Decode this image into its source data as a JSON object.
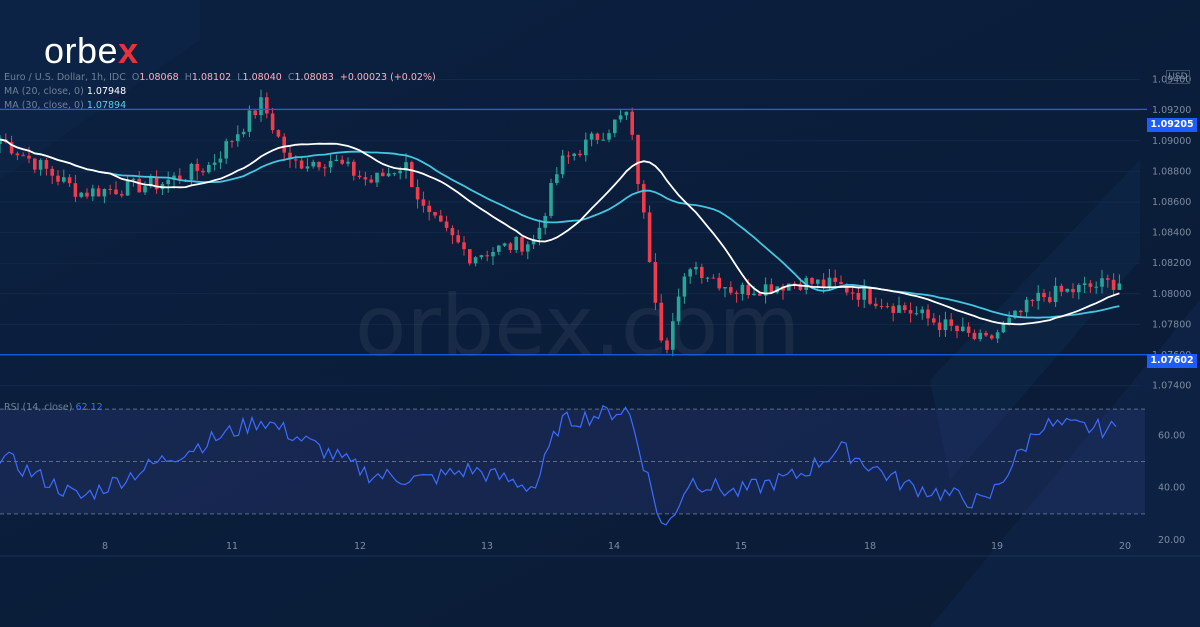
{
  "brand": {
    "logo_main": "orbe",
    "logo_accent": "x",
    "watermark": "orbex.com"
  },
  "legend": {
    "symbol": "Euro / U.S. Dollar, 1h, IDC",
    "o_label": "O",
    "o_value": "1.08068",
    "h_label": "H",
    "h_value": "1.08102",
    "l_label": "L",
    "l_value": "1.08040",
    "c_label": "C",
    "c_value": "1.08083",
    "change": "+0.00023 (+0.02%)",
    "ma20_label": "MA (20, close, 0)",
    "ma20_value": "1.07948",
    "ma30_label": "MA (30, close, 0)",
    "ma30_value": "1.07894",
    "rsi_label": "RSI (14, close)",
    "rsi_value": "62.12"
  },
  "colors": {
    "background": "#0b1f3b",
    "up": "#26a69a",
    "down": "#ef3b4b",
    "ma20": "#ffffff",
    "ma30": "#45c6e0",
    "level_line": "#1d5cff",
    "rsi_line": "#3c6cff",
    "rsi_band": "#2a3a78",
    "axis_text": "#7b8aa0"
  },
  "chart_data": [
    {
      "type": "candlestick",
      "title": "Euro / U.S. Dollar, 1h, IDC",
      "currency": "USD",
      "ylim": [
        1.0728,
        1.0958
      ],
      "y_ticks": [
        "1.07400",
        "1.07600",
        "1.07800",
        "1.08000",
        "1.08200",
        "1.08400",
        "1.08600",
        "1.08800",
        "1.09000",
        "1.09200",
        "1.09400"
      ],
      "x_ticks": [
        "8",
        "11",
        "12",
        "13",
        "14",
        "15",
        "18",
        "19",
        "20"
      ],
      "horizontal_levels": [
        "1.09205",
        "1.07602"
      ],
      "anchor_ohlc": [
        {
          "label": "8 start",
          "close": 1.0901
        },
        {
          "label": "8 mid",
          "close": 1.0866
        },
        {
          "label": "8 end",
          "close": 1.0872
        },
        {
          "label": "11 start",
          "close": 1.0884
        },
        {
          "label": "11 high",
          "close": 1.0925
        },
        {
          "label": "11 mid",
          "close": 1.0885
        },
        {
          "label": "12 start",
          "close": 1.0888
        },
        {
          "label": "12 mid",
          "close": 1.0873
        },
        {
          "label": "12 end",
          "close": 1.0885
        },
        {
          "label": "13 start",
          "close": 1.0852
        },
        {
          "label": "13 mid",
          "close": 1.0825
        },
        {
          "label": "13 end",
          "close": 1.0835
        },
        {
          "label": "14 start",
          "close": 1.0885
        },
        {
          "label": "14 high",
          "close": 1.0918
        },
        {
          "label": "14 crash",
          "close": 1.0762
        },
        {
          "label": "15 start",
          "close": 1.082
        },
        {
          "label": "15 mid",
          "close": 1.0802
        },
        {
          "label": "18 start",
          "close": 1.0808
        },
        {
          "label": "18 mid",
          "close": 1.0805
        },
        {
          "label": "18 end",
          "close": 1.079
        },
        {
          "label": "19 start",
          "close": 1.0768
        },
        {
          "label": "19 mid",
          "close": 1.0798
        },
        {
          "label": "20",
          "close": 1.08083
        }
      ],
      "series": [
        {
          "name": "MA (20, close, 0)",
          "last": 1.07948
        },
        {
          "name": "MA (30, close, 0)",
          "last": 1.07894
        }
      ]
    },
    {
      "type": "line",
      "title": "RSI (14, close)",
      "ylim": [
        20,
        75
      ],
      "y_ticks": [
        "20.00",
        "40.00",
        "60.00"
      ],
      "band": [
        30,
        70
      ],
      "anchors": [
        {
          "pos": "8 start",
          "value": 52
        },
        {
          "pos": "8 mid",
          "value": 36
        },
        {
          "pos": "8 end",
          "value": 50
        },
        {
          "pos": "11 start",
          "value": 58
        },
        {
          "pos": "11 high",
          "value": 66
        },
        {
          "pos": "12 start",
          "value": 53
        },
        {
          "pos": "12 mid",
          "value": 45
        },
        {
          "pos": "13 start",
          "value": 43
        },
        {
          "pos": "13 mid",
          "value": 47
        },
        {
          "pos": "13 end",
          "value": 40
        },
        {
          "pos": "14 start",
          "value": 65
        },
        {
          "pos": "14 high",
          "value": 70
        },
        {
          "pos": "14 crash",
          "value": 23
        },
        {
          "pos": "15 start",
          "value": 43
        },
        {
          "pos": "15 mid",
          "value": 38
        },
        {
          "pos": "18 start",
          "value": 45
        },
        {
          "pos": "18 mid",
          "value": 55
        },
        {
          "pos": "18 end",
          "value": 41
        },
        {
          "pos": "19 start",
          "value": 34
        },
        {
          "pos": "19 mid",
          "value": 64
        },
        {
          "pos": "20",
          "value": 62.12
        }
      ]
    }
  ]
}
